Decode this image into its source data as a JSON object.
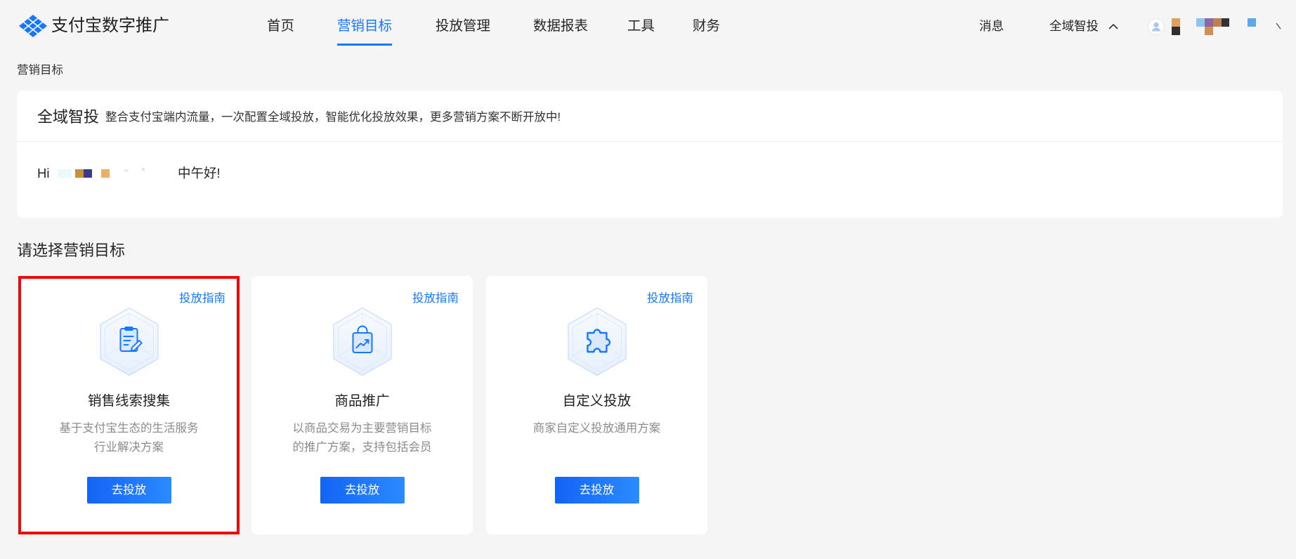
{
  "header": {
    "brand": "支付宝数字推广",
    "brand_icon": "alipay-logo-icon",
    "nav": [
      {
        "label": "首页",
        "active": false
      },
      {
        "label": "营销目标",
        "active": true
      },
      {
        "label": "投放管理",
        "active": false
      },
      {
        "label": "数据报表",
        "active": false
      },
      {
        "label": "工具",
        "active": false
      },
      {
        "label": "财务",
        "active": false
      }
    ],
    "messages": "消息",
    "product_switcher": {
      "label": "全域智投",
      "icon": "chevron-up-icon"
    },
    "user": {
      "avatar_icon": "user-avatar-icon"
    }
  },
  "breadcrumb": "营销目标",
  "intro": {
    "title": "全域智投",
    "description": "整合支付宝端内流量，一次配置全域投放，智能优化投放效果，更多营销方案不断开放中!",
    "greeting_prefix": "Hi",
    "greeting_suffix": "中午好!"
  },
  "section_title": "请选择营销目标",
  "goals": [
    {
      "title": "销售线索搜集",
      "description": [
        "基于支付宝生态的生活服务",
        "行业解决方案"
      ],
      "guide_link": "投放指南",
      "button": "去投放",
      "icon": "document-edit-icon"
    },
    {
      "title": "商品推广",
      "description": [
        "以商品交易为主要营销目标",
        "的推广方案，支持包括会员"
      ],
      "guide_link": "投放指南",
      "button": "去投放",
      "icon": "shopping-bag-trend-icon"
    },
    {
      "title": "自定义投放",
      "description": [
        "商家自定义投放通用方案"
      ],
      "guide_link": "投放指南",
      "button": "去投放",
      "icon": "puzzle-icon"
    }
  ],
  "colors": {
    "accent": "#1677ff",
    "page_background": "#f5f5f5",
    "highlight": "#ee0a0a"
  }
}
